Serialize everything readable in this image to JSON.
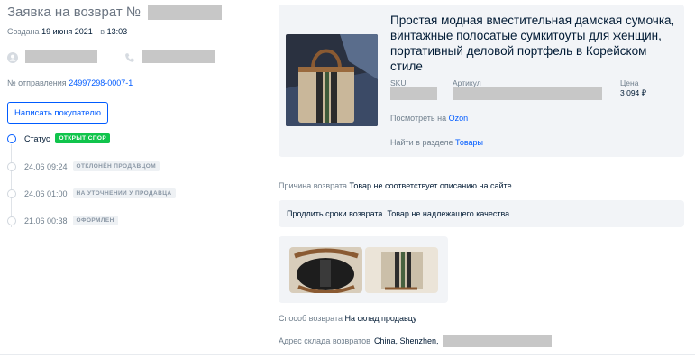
{
  "header": {
    "title": "Заявка на возврат №",
    "created_label": "Создана",
    "created_date": "19 июня 2021",
    "created_at_label": "в",
    "created_time": "13:03"
  },
  "shipment": {
    "label": "№ отправления",
    "number": "24997298-0007-1"
  },
  "actions": {
    "write_buyer": "Написать покупателю"
  },
  "timeline": [
    {
      "text": "Статус",
      "badge": "ОТКРЫТ СПОР",
      "active": true
    },
    {
      "text": "24.06 09:24",
      "badge": "ОТКЛОНЁН ПРОДАВЦОМ",
      "active": false
    },
    {
      "text": "24.06 01:00",
      "badge": "НА УТОЧНЕНИИ У ПРОДАВЦА",
      "active": false
    },
    {
      "text": "21.06 00:38",
      "badge": "ОФОРМЛЕН",
      "active": false
    }
  ],
  "product": {
    "title": "Простая модная вместительная дамская сумочка, винтажные полосатые сумкитоуты для женщин, портативный деловой портфель в Корейском стиле",
    "sku_label": "SKU",
    "article_label": "Артикул",
    "price_label": "Цена",
    "price": "3 094 ₽",
    "view_label": "Посмотреть на",
    "view_link": "Ozon",
    "section_label": "Найти в разделе",
    "section_link": "Товары"
  },
  "return": {
    "reason_label": "Причина возврата",
    "reason_value": "Товар не соответствует описанию на сайте",
    "comment": "Продлить сроки возврата. Товар не надлежащего качества",
    "method_label": "Способ возврата",
    "method_value": "На склад продавцу",
    "address_label": "Адрес склада возвратов",
    "address_value": "China, Shenzhen,"
  },
  "colors": {
    "accent": "#005bff",
    "status_green": "#10c44c",
    "panel_bg": "#f2f4f7",
    "redaction": "#c7c7c7"
  }
}
